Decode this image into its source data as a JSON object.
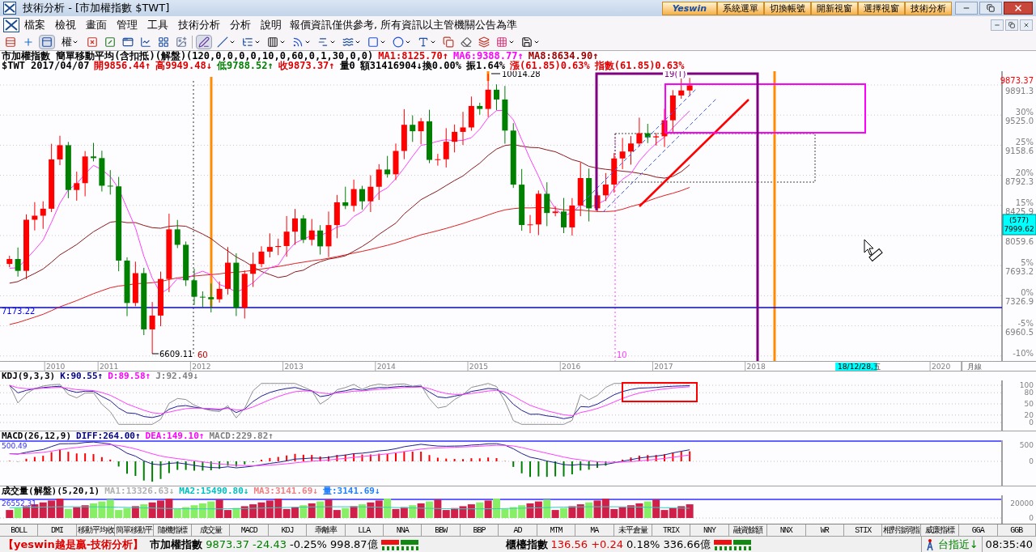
{
  "window": {
    "title": "技術分析 - [市加權指數 $TWT]"
  },
  "quick_buttons": [
    "系統選單",
    "切換帳號",
    "開新視窗",
    "選擇視窗",
    "技術分析"
  ],
  "brand": "Yeswin",
  "menu": [
    "檔案",
    "檢視",
    "畫面",
    "管理",
    "工具",
    "技術分析",
    "分析",
    "說明"
  ],
  "notice": "報價資訊僅供參考, 所有資訊以主管機關公告為準",
  "toolbar": {
    "rights_label": "權"
  },
  "chart": {
    "header": [
      [
        {
          "text": "市加權指數 簡單移動平均(含扣抵)(解盤)(120,0,0,0,0,10,0,60,0,1,30,0,0)",
          "color": "#000000"
        },
        {
          "text": "MA1:8125.70↑",
          "color": "#e00000"
        },
        {
          "text": "MA6:9388.77↑",
          "color": "#ff00ff"
        },
        {
          "text": "MA8:8634.90↑",
          "color": "#a00000"
        }
      ],
      [
        {
          "text": "$TWT 2017/04/07",
          "color": "#000000"
        },
        {
          "text": "開9856.44↑",
          "color": "#e00000"
        },
        {
          "text": "高9949.48↓",
          "color": "#e00000"
        },
        {
          "text": "低9788.52↑",
          "color": "#008000"
        },
        {
          "text": "收9873.37↑",
          "color": "#e00000"
        },
        {
          "text": "量0",
          "color": "#000000"
        },
        {
          "text": "額31416904↓換0.00%",
          "color": "#000000"
        },
        {
          "text": "振1.64%",
          "color": "#000000"
        },
        {
          "text": "漲(61.85)0.63%",
          "color": "#e00000"
        },
        {
          "text": "指數(61.85)0.63%",
          "color": "#e00000"
        }
      ]
    ],
    "price_axis": [
      {
        "price": "9891.3"
      },
      {
        "percent": "30%",
        "price": "9525.0"
      },
      {
        "percent": "25%",
        "price": "9158.6"
      },
      {
        "percent": "20%",
        "price": "8792.3"
      },
      {
        "percent": "15%",
        "price": "8425.9"
      },
      {
        "price": "8059.6"
      },
      {
        "percent": "5%",
        "price": "7693.2"
      },
      {
        "percent": "0%",
        "price": "7326.9"
      },
      {
        "percent": "-5%",
        "price": "6960.5"
      },
      {
        "percent": "-10%"
      }
    ],
    "last_price": "9873.37",
    "crosshair": {
      "count": "(577)",
      "price": "7999.62"
    },
    "base_line_label": "7173.22",
    "high_label": "10014.28",
    "low_label": "6609.11",
    "period_marks": [
      "60",
      "10"
    ],
    "span_label": "19(T)",
    "time_axis": [
      {
        "text": "2010",
        "kind": "year"
      },
      {
        "text": "2011",
        "kind": "year"
      },
      {
        "text": "2012",
        "kind": "year"
      },
      {
        "text": "2013",
        "kind": "year"
      },
      {
        "text": "2014",
        "kind": "year"
      },
      {
        "text": "2015",
        "kind": "year"
      },
      {
        "text": "2016",
        "kind": "year"
      },
      {
        "text": "2017",
        "kind": "year"
      },
      {
        "text": "2018",
        "kind": "year"
      },
      {
        "text": "18/12/28,五",
        "kind": "cursor"
      },
      {
        "text": "2020",
        "kind": "year"
      }
    ],
    "period": "月線"
  },
  "kdj": {
    "header": [
      {
        "text": "KDJ(9,3,3)",
        "color": "#000000"
      },
      {
        "text": "K:90.55↑",
        "color": "#000080"
      },
      {
        "text": "D:89.58↑",
        "color": "#ff00ff"
      },
      {
        "text": "J:92.49↓",
        "color": "#808080"
      }
    ],
    "axis": [
      "100",
      "80",
      "50",
      "20",
      "0"
    ]
  },
  "macd": {
    "header": [
      {
        "text": "MACD(26,12,9)",
        "color": "#000000"
      },
      {
        "text": "DIFF:264.00↑",
        "color": "#000080"
      },
      {
        "text": "DEA:149.10↑",
        "color": "#ff00ff"
      },
      {
        "text": "MACD:229.82↑",
        "color": "#808080"
      }
    ],
    "left_label": "500.49",
    "axis": [
      "500",
      "0"
    ]
  },
  "volume": {
    "header": [
      {
        "text": "成交量(解盤)(5,20,1)",
        "color": "#000000"
      },
      {
        "text": "MA1:13326.63↓",
        "color": "#b0b0b0"
      },
      {
        "text": "MA2:15490.80↓",
        "color": "#00c0c0"
      },
      {
        "text": "MA3:3141.69↓",
        "color": "#f08080"
      },
      {
        "text": "量:3141.69↓",
        "color": "#2080ff"
      }
    ],
    "left_label": "26552.31",
    "axis": [
      "20000",
      "0"
    ]
  },
  "indicator_tabs": [
    "BOLL",
    "DMI",
    "移動平均收",
    "簡單移動平",
    "隨機指標",
    "成交量",
    "MACD",
    "KDJ",
    "乖離率",
    "LLA",
    "NNA",
    "BBW",
    "BBP",
    "AD",
    "MTM",
    "MA",
    "未平倉量",
    "TRIX",
    "NNY",
    "融資餘額",
    "NNX",
    "WR",
    "STIX",
    "相對強弱指",
    "威廉指標",
    "GGA",
    "GGB"
  ],
  "status": {
    "slogan": "【yeswin越是贏-技術分析】",
    "markets": [
      {
        "name": "市加權指數",
        "change": "9873.37 -24.43",
        "color": "#008000",
        "rest": "-0.25% 998.87億"
      },
      {
        "name": "櫃檯指數",
        "change": "136.56 +0.24",
        "color": "#e00000",
        "rest": "0.18% 336.66億"
      }
    ],
    "futures": "台指近↓",
    "time": "08:35:40"
  }
}
